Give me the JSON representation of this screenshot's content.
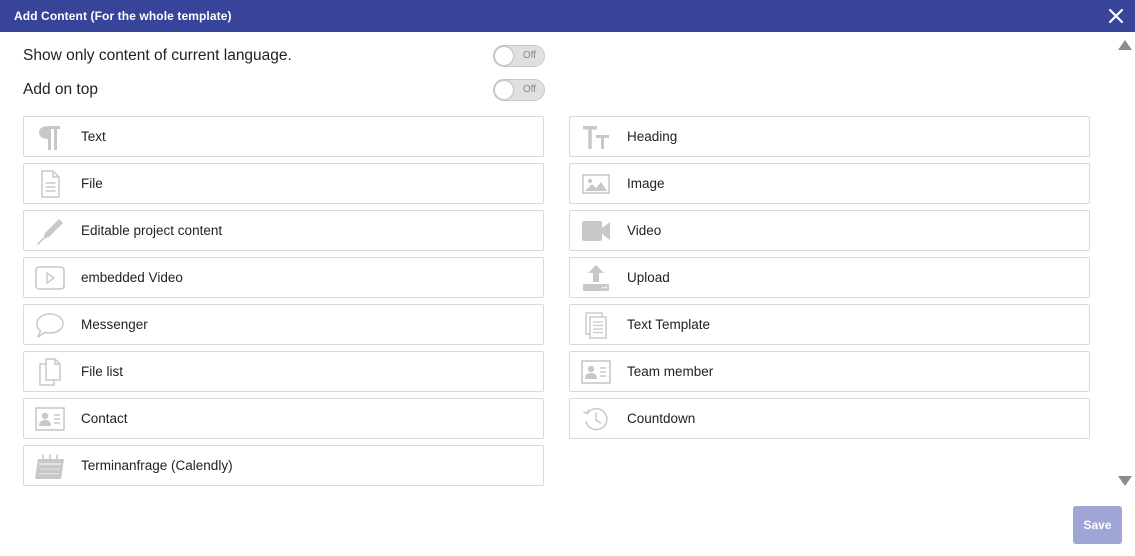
{
  "dialog": {
    "title": "Add Content (For the whole template)",
    "close_icon": "close-icon",
    "accent_color": "#38439a"
  },
  "options": {
    "current_language": {
      "label": "Show only content of current language.",
      "state": "Off"
    },
    "add_on_top": {
      "label": "Add on top",
      "state": "Off"
    }
  },
  "content_types": [
    {
      "label": "Text",
      "icon": "paragraph-icon"
    },
    {
      "label": "Heading",
      "icon": "heading-icon"
    },
    {
      "label": "File",
      "icon": "file-icon"
    },
    {
      "label": "Image",
      "icon": "image-icon"
    },
    {
      "label": "Editable project content",
      "icon": "pen-icon"
    },
    {
      "label": "Video",
      "icon": "video-camera-icon"
    },
    {
      "label": "embedded Video",
      "icon": "play-icon"
    },
    {
      "label": "Upload",
      "icon": "upload-icon"
    },
    {
      "label": "Messenger",
      "icon": "speech-bubble-icon"
    },
    {
      "label": "Text Template",
      "icon": "text-template-icon"
    },
    {
      "label": "File list",
      "icon": "file-list-icon"
    },
    {
      "label": "Team member",
      "icon": "team-member-icon"
    },
    {
      "label": "Contact",
      "icon": "contact-card-icon"
    },
    {
      "label": "Countdown",
      "icon": "countdown-icon"
    },
    {
      "label": "Terminanfrage (Calendly)",
      "icon": "calendar-icon"
    }
  ],
  "footer": {
    "save_label": "Save",
    "save_color": "#9fa5d4"
  }
}
